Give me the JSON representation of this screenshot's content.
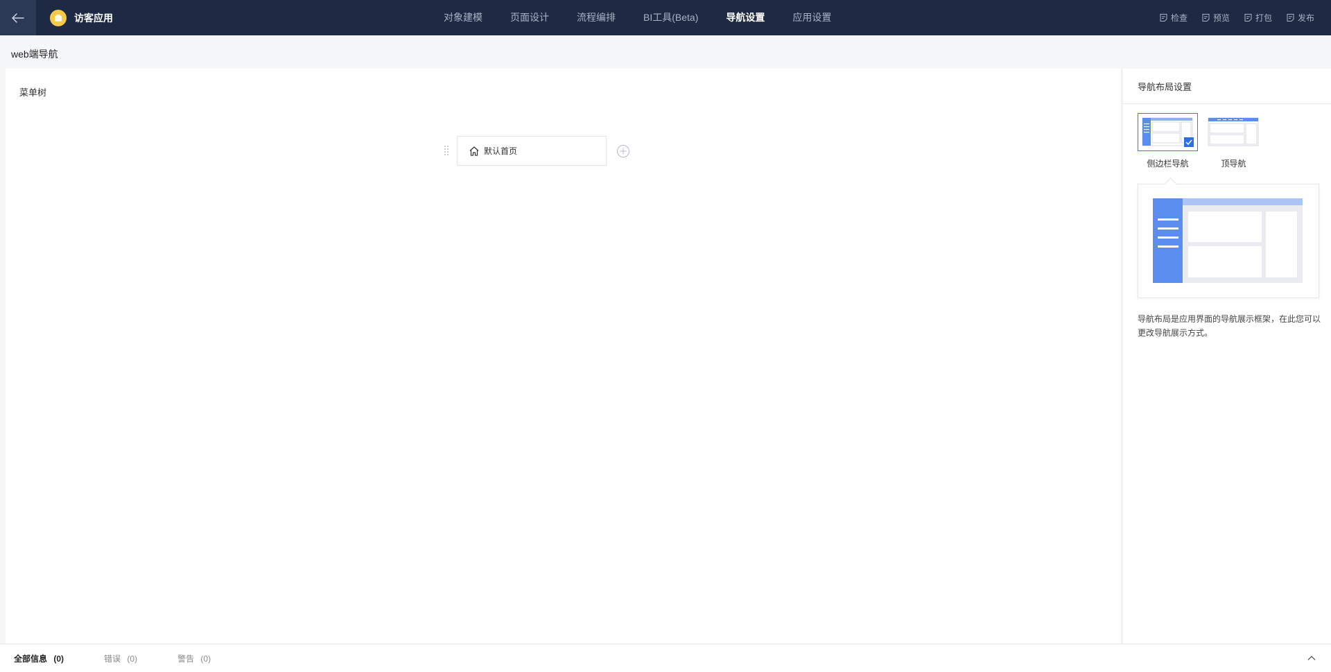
{
  "app": {
    "title": "访客应用",
    "logo_color": "#f7c948"
  },
  "nav": {
    "tabs": [
      {
        "label": "对象建模"
      },
      {
        "label": "页面设计"
      },
      {
        "label": "流程编排"
      },
      {
        "label": "BI工具(Beta)"
      },
      {
        "label": "导航设置",
        "active": true
      },
      {
        "label": "应用设置"
      }
    ]
  },
  "actions": [
    {
      "label": "检查",
      "icon": "check-doc-icon"
    },
    {
      "label": "预览",
      "icon": "preview-icon"
    },
    {
      "label": "打包",
      "icon": "package-icon"
    },
    {
      "label": "发布",
      "icon": "publish-icon"
    }
  ],
  "subheader": {
    "title": "web端导航"
  },
  "canvas": {
    "title": "菜单树",
    "menu_items": [
      {
        "label": "默认首页",
        "icon": "home-icon"
      }
    ]
  },
  "right_panel": {
    "title": "导航布局设置",
    "options": [
      {
        "label": "侧边栏导航",
        "selected": true
      },
      {
        "label": "顶导航",
        "selected": false
      }
    ],
    "description": "导航布局是应用界面的导航展示框架，在此您可以更改导航展示方式。",
    "accent_color": "#3a73e8"
  },
  "bottom_bar": {
    "tabs": [
      {
        "label": "全部信息",
        "count": "(0)",
        "active": true
      },
      {
        "label": "错误",
        "count": "(0)"
      },
      {
        "label": "警告",
        "count": "(0)"
      }
    ]
  }
}
